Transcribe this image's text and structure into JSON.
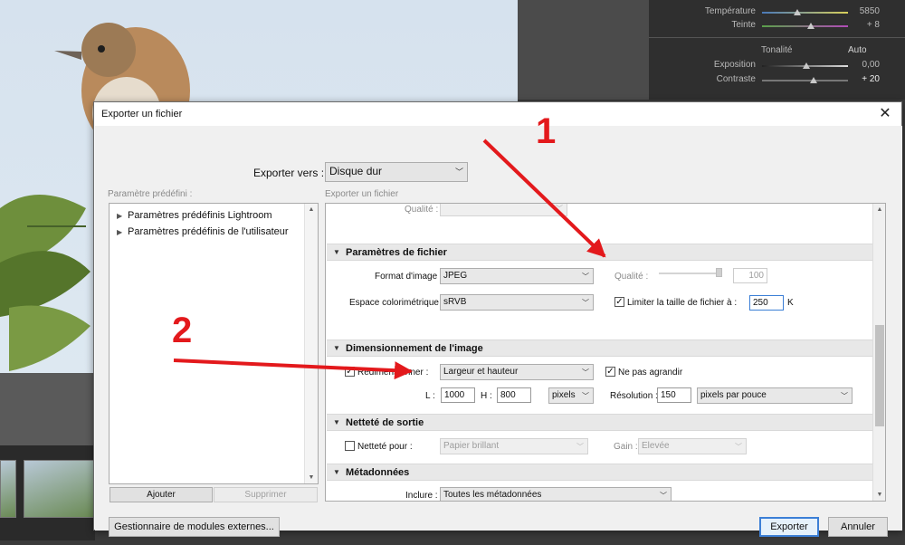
{
  "background_app": {
    "panel": {
      "sliders": [
        {
          "label": "Température",
          "value": "5850",
          "thumb_fraction": 0.38
        },
        {
          "label": "Teinte",
          "value": "+ 8",
          "thumb_fraction": 0.55
        },
        {
          "label": "Exposition",
          "value": "0,00",
          "thumb_fraction": 0.5
        },
        {
          "label": "Contraste",
          "value": "+ 20",
          "thumb_fraction": 0.58
        }
      ],
      "tonality_label": "Tonalité",
      "auto_label": "Auto"
    }
  },
  "dialog": {
    "title": "Exporter un fichier",
    "export_to": {
      "label": "Exporter vers :",
      "value": "Disque dur"
    },
    "preset_header": "Paramètre prédéfini :",
    "export_file_header": "Exporter un fichier",
    "presets": [
      "Paramètres prédéfinis Lightroom",
      "Paramètres prédéfinis de l'utilisateur"
    ],
    "add_button": "Ajouter",
    "remove_button": "Supprimer",
    "plugin_manager_button": "Gestionnaire de modules externes...",
    "export_button": "Exporter",
    "cancel_button": "Annuler",
    "settings": {
      "quality_top_label": "Qualité :",
      "file_section": {
        "title": "Paramètres de fichier",
        "format_label": "Format d'image :",
        "format_value": "JPEG",
        "colorspace_label": "Espace colorimétrique :",
        "colorspace_value": "sRVB",
        "quality_label": "Qualité :",
        "quality_value": "100",
        "limit_label": "Limiter la taille de fichier à :",
        "limit_checked": "✓",
        "limit_value": "250",
        "limit_unit": "K"
      },
      "size_section": {
        "title": "Dimensionnement de l'image",
        "resize_label": "Redimensionner :",
        "resize_checked": "✓",
        "resize_mode": "Largeur et hauteur",
        "no_enlarge_label": "Ne pas agrandir",
        "no_enlarge_checked": "✓",
        "width_label": "L :",
        "width_value": "1000",
        "height_label": "H :",
        "height_value": "800",
        "unit_value": "pixels",
        "resolution_label": "Résolution :",
        "resolution_value": "150",
        "resolution_unit": "pixels par pouce"
      },
      "sharpen_section": {
        "title": "Netteté de sortie",
        "sharpen_label": "Netteté pour :",
        "sharpen_value": "Papier brillant",
        "gain_label": "Gain :",
        "gain_value": "Elevée"
      },
      "metadata_section": {
        "title": "Métadonnées",
        "include_label": "Inclure :",
        "include_value": "Toutes les métadonnées"
      }
    }
  },
  "annotations": {
    "marker_1": "1",
    "marker_2": "2",
    "color": "#e3191c"
  }
}
